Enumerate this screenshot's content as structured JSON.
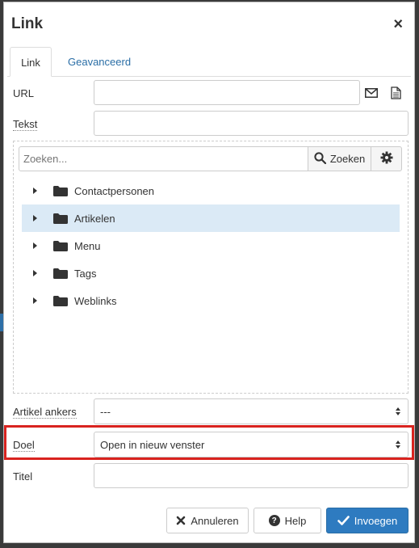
{
  "dialog": {
    "title": "Link",
    "close_icon": "close-icon"
  },
  "tabs": [
    {
      "label": "Link",
      "active": true
    },
    {
      "label": "Geavanceerd",
      "active": false
    }
  ],
  "form": {
    "url_label": "URL",
    "url_value": "",
    "text_label": "Tekst",
    "text_value": "",
    "anchors_label": "Artikel ankers",
    "anchors_value": "---",
    "target_label": "Doel",
    "target_value": "Open in nieuw venster",
    "title_label": "Titel",
    "title_value": ""
  },
  "browser": {
    "search_placeholder": "Zoeken...",
    "search_button": "Zoeken",
    "tree": [
      {
        "label": "Contactpersonen",
        "selected": false
      },
      {
        "label": "Artikelen",
        "selected": true
      },
      {
        "label": "Menu",
        "selected": false
      },
      {
        "label": "Tags",
        "selected": false
      },
      {
        "label": "Weblinks",
        "selected": false
      }
    ]
  },
  "buttons": {
    "cancel": "Annuleren",
    "help": "Help",
    "insert": "Invoegen"
  },
  "colors": {
    "accent": "#2e7bc0",
    "selection": "#dbeaf6",
    "highlight": "#d9231f"
  }
}
